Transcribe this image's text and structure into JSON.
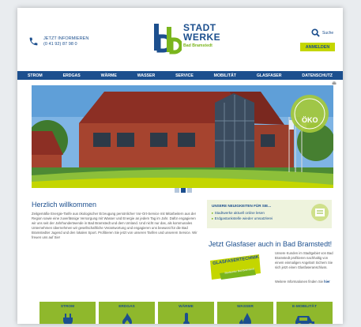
{
  "header": {
    "contact_line1": "JETZT INFORMIEREN",
    "contact_line2": "(0 41 92) 87 98 0",
    "logo_line1": "STADT",
    "logo_line2": "WERKE",
    "logo_line3": "Bad Bramstedt",
    "search_label": "Suche",
    "login_label": "ANMELDEN"
  },
  "nav": {
    "items": [
      "STROM",
      "ERDGAS",
      "WÄRME",
      "WASSER",
      "SERVICE",
      "MOBILITÄT",
      "GLASFASER",
      "DATENSCHUTZ"
    ]
  },
  "hero": {
    "badge_text": "ÖKO"
  },
  "welcome": {
    "title": "Herzlich willkommen",
    "text": "Zeitgemäße Energie-Tarife aus ökologischer Erzeugung persönlicher Vor-Ort-Service mit Mitarbeitern aus der Region sowie eine zuverlässige Versorgung mit Wasser und Energie an jedem Tag im Jahr. Dafür engagieren wir uns seit der Jahrhundertwende in Bad Bramstedt und dem Umland. Und nicht nur das, als kommunales Unternehmen übernehmen wir gesellschaftliche Verantwortung und engagieren uns bewusst für die Bad Bramstedter Jugend und den lokalen Sport. Profitieren Sie jetzt von unseren Tarifen und unserem Service. Wir freuen uns auf Sie!"
  },
  "news": {
    "title": "UNSERE NEUIGKEITEN FÜR SIE...",
    "items": [
      "Stadtwerke aktuell online lesen",
      "Erdgastankstelle wieder umsatzlerei"
    ]
  },
  "glasfaser": {
    "title": "Jetzt Glasfaser auch in Bad Bramstedt!",
    "badge_text": "GLASFASERTECHNIK",
    "badge_sub": "Stadtwerke Bad Bramstedt",
    "text": "Unsere Kunden im Stadtgebiet von Bad Bramstedt profitieren nachhaltig von einem einmaligen Angebot! Sichern Sie sich jetzt einen Glasfaseranschluss.",
    "more_prefix": "Weitere Informationen finden Sie",
    "more_link": "hier"
  },
  "tiles": [
    "STROM",
    "ERDGAS",
    "WÄRME",
    "WASSER",
    "E-MOBILITÄT"
  ],
  "colors": {
    "brand_blue": "#1c4f8e",
    "accent_green": "#7ab51d",
    "lime": "#c4d600",
    "tile_green": "#8fb82c"
  }
}
